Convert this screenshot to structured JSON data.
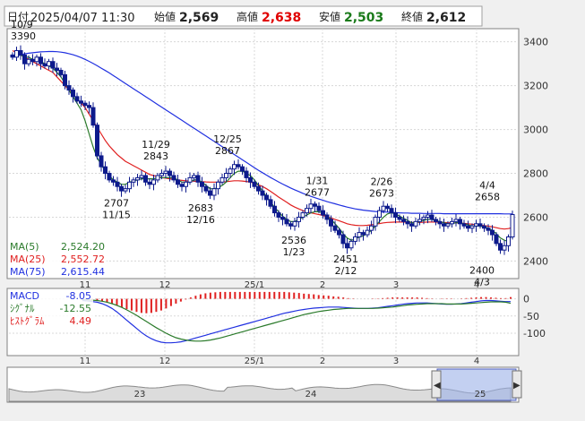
{
  "header": {
    "date_label": "日付",
    "datetime": "2025/04/07 11:30",
    "open_label": "始値",
    "open": "2,569",
    "high_label": "高値",
    "high": "2,638",
    "low_label": "安値",
    "low": "2,503",
    "close_label": "終値",
    "close": "2,612"
  },
  "colors": {
    "up": "#0d1a8c",
    "down": "#0d1a8c",
    "ma5": "#2a7a2a",
    "ma25": "#e02020",
    "ma75": "#2030e0",
    "high_value": "#e00000",
    "low_value": "#1a7a1a",
    "macd": "#2030e0",
    "signal": "#2a7a2a",
    "histogram": "#e02020"
  },
  "legend": {
    "ma5_label": "MA(5)",
    "ma5_value": "2,524.20",
    "ma25_label": "MA(25)",
    "ma25_value": "2,552.72",
    "ma75_label": "MA(75)",
    "ma75_value": "2,615.44"
  },
  "macd_legend": {
    "macd_label": "MACD",
    "macd_value": "-8.05",
    "signal_label": "ｼｸﾞﾅﾙ",
    "signal_value": "-12.55",
    "hist_label": "ﾋｽﾄｸﾞﾗﾑ",
    "hist_value": "4.49"
  },
  "chart_data": {
    "type": "candlestick",
    "y_ticks": [
      "3400",
      "3200",
      "3000",
      "2800",
      "2600",
      "2400"
    ],
    "ylim": [
      2320,
      3460
    ],
    "x_ticks": [
      "11",
      "12",
      "25/1",
      "2",
      "3",
      "4"
    ],
    "macd_ticks": [
      "0",
      "-50",
      "-100"
    ],
    "macd_ylim": [
      -160,
      25
    ],
    "navigator_labels": [
      "23",
      "24",
      "25"
    ],
    "annotations": [
      {
        "date": "10/9",
        "value": "3390",
        "pos": "above"
      },
      {
        "date": "11/29",
        "value": "2843",
        "pos": "above"
      },
      {
        "date": "12/25",
        "value": "2867",
        "pos": "above"
      },
      {
        "date": "1/31",
        "value": "2677",
        "pos": "above"
      },
      {
        "date": "2/26",
        "value": "2673",
        "pos": "above"
      },
      {
        "date": "4/4",
        "value": "2658",
        "pos": "above"
      },
      {
        "date": "11/15",
        "value": "2707",
        "pos": "below"
      },
      {
        "date": "12/16",
        "value": "2683",
        "pos": "below"
      },
      {
        "date": "1/23",
        "value": "2536",
        "pos": "below"
      },
      {
        "date": "2/12",
        "value": "2451",
        "pos": "below"
      },
      {
        "date": "4/3",
        "value": "2400",
        "pos": "below"
      }
    ],
    "closes": [
      3330,
      3360,
      3340,
      3300,
      3320,
      3310,
      3330,
      3300,
      3290,
      3310,
      3280,
      3270,
      3250,
      3200,
      3180,
      3150,
      3130,
      3120,
      3110,
      3100,
      3020,
      2880,
      2830,
      2800,
      2770,
      2760,
      2740,
      2720,
      2730,
      2760,
      2770,
      2780,
      2790,
      2760,
      2750,
      2770,
      2790,
      2800,
      2810,
      2790,
      2770,
      2750,
      2740,
      2760,
      2780,
      2790,
      2760,
      2740,
      2720,
      2700,
      2730,
      2760,
      2780,
      2800,
      2820,
      2840,
      2830,
      2810,
      2780,
      2760,
      2740,
      2720,
      2700,
      2680,
      2650,
      2620,
      2600,
      2590,
      2570,
      2560,
      2580,
      2600,
      2620,
      2640,
      2660,
      2650,
      2630,
      2610,
      2590,
      2560,
      2540,
      2520,
      2480,
      2460,
      2490,
      2510,
      2530,
      2520,
      2540,
      2560,
      2600,
      2630,
      2650,
      2640,
      2620,
      2600,
      2590,
      2580,
      2570,
      2560,
      2580,
      2590,
      2600,
      2610,
      2590,
      2580,
      2570,
      2560,
      2570,
      2580,
      2590,
      2570,
      2560,
      2550,
      2560,
      2570,
      2560,
      2550,
      2540,
      2520,
      2480,
      2450,
      2470,
      2510,
      2612
    ],
    "ma5": [
      3330,
      3340,
      3340,
      3330,
      3330,
      3320,
      3315,
      3310,
      3300,
      3290,
      3280,
      3260,
      3240,
      3210,
      3180,
      3150,
      3120,
      3090,
      3040,
      2980,
      2920,
      2870,
      2840,
      2810,
      2790,
      2770,
      2760,
      2750,
      2750,
      2760,
      2765,
      2770,
      2775,
      2775,
      2775,
      2775,
      2780,
      2780,
      2780,
      2780,
      2780,
      2770,
      2760,
      2760,
      2760,
      2770,
      2770,
      2760,
      2745,
      2730,
      2730,
      2735,
      2745,
      2760,
      2780,
      2800,
      2810,
      2810,
      2800,
      2790,
      2770,
      2745,
      2720,
      2695,
      2670,
      2645,
      2625,
      2605,
      2590,
      2580,
      2580,
      2590,
      2600,
      2610,
      2620,
      2625,
      2625,
      2620,
      2605,
      2590,
      2570,
      2550,
      2525,
      2505,
      2495,
      2500,
      2510,
      2515,
      2525,
      2540,
      2560,
      2580,
      2600,
      2615,
      2620,
      2615,
      2605,
      2595,
      2585,
      2575,
      2575,
      2580,
      2585,
      2590,
      2590,
      2585,
      2580,
      2575,
      2570,
      2570,
      2575,
      2575,
      2570,
      2565,
      2560,
      2560,
      2560,
      2555,
      2550,
      2540,
      2525,
      2505,
      2495,
      2490,
      2524
    ],
    "ma25": [
      3360,
      3350,
      3340,
      3330,
      3320,
      3310,
      3300,
      3290,
      3280,
      3270,
      3260,
      3240,
      3220,
      3200,
      3180,
      3160,
      3140,
      3120,
      3100,
      3070,
      3040,
      3010,
      2980,
      2950,
      2925,
      2905,
      2885,
      2870,
      2855,
      2845,
      2835,
      2825,
      2815,
      2805,
      2795,
      2790,
      2785,
      2780,
      2778,
      2775,
      2772,
      2770,
      2768,
      2766,
      2765,
      2764,
      2763,
      2762,
      2761,
      2760,
      2760,
      2760,
      2761,
      2762,
      2764,
      2766,
      2766,
      2765,
      2763,
      2760,
      2755,
      2748,
      2740,
      2730,
      2718,
      2705,
      2692,
      2680,
      2668,
      2656,
      2646,
      2638,
      2630,
      2624,
      2620,
      2616,
      2612,
      2608,
      2602,
      2596,
      2590,
      2584,
      2577,
      2570,
      2566,
      2563,
      2562,
      2562,
      2563,
      2565,
      2568,
      2571,
      2574,
      2576,
      2577,
      2578,
      2578,
      2578,
      2577,
      2576,
      2576,
      2576,
      2577,
      2578,
      2578,
      2578,
      2577,
      2576,
      2575,
      2574,
      2574,
      2573,
      2572,
      2570,
      2568,
      2566,
      2564,
      2562,
      2559,
      2556,
      2552,
      2548,
      2546,
      2548,
      2553
    ],
    "ma75": [
      3330,
      3335,
      3340,
      3345,
      3348,
      3350,
      3352,
      3354,
      3355,
      3356,
      3356,
      3355,
      3353,
      3350,
      3346,
      3341,
      3335,
      3328,
      3320,
      3311,
      3301,
      3291,
      3280,
      3269,
      3258,
      3246,
      3234,
      3222,
      3210,
      3198,
      3186,
      3174,
      3162,
      3150,
      3138,
      3126,
      3114,
      3102,
      3090,
      3078,
      3066,
      3054,
      3042,
      3030,
      3018,
      3006,
      2994,
      2982,
      2970,
      2958,
      2946,
      2934,
      2922,
      2910,
      2898,
      2886,
      2874,
      2862,
      2850,
      2838,
      2826,
      2814,
      2803,
      2792,
      2781,
      2771,
      2761,
      2751,
      2742,
      2733,
      2725,
      2717,
      2709,
      2702,
      2695,
      2689,
      2683,
      2677,
      2671,
      2666,
      2661,
      2656,
      2651,
      2646,
      2642,
      2638,
      2635,
      2632,
      2630,
      2628,
      2626,
      2625,
      2624,
      2623,
      2622,
      2621,
      2620,
      2619,
      2619,
      2618,
      2618,
      2618,
      2617,
      2617,
      2617,
      2617,
      2617,
      2616,
      2616,
      2616,
      2616,
      2616,
      2616,
      2616,
      2616,
      2616,
      2616,
      2616,
      2616,
      2616,
      2616,
      2616,
      2615,
      2615,
      2615
    ],
    "macd": [
      -5,
      -6,
      -8,
      -10,
      -14,
      -20,
      -28,
      -38,
      -50,
      -62,
      -74,
      -86,
      -98,
      -108,
      -116,
      -122,
      -126,
      -128,
      -128,
      -127,
      -125,
      -122,
      -118,
      -114,
      -110,
      -106,
      -102,
      -98,
      -94,
      -90,
      -86,
      -82,
      -78,
      -74,
      -70,
      -66,
      -62,
      -58,
      -54,
      -50,
      -46,
      -42,
      -39,
      -36,
      -33,
      -31,
      -29,
      -27,
      -26,
      -25,
      -24,
      -24,
      -24,
      -25,
      -26,
      -27,
      -28,
      -28,
      -28,
      -27,
      -26,
      -24,
      -22,
      -20,
      -18,
      -16,
      -14,
      -13,
      -12,
      -12,
      -12,
      -13,
      -14,
      -15,
      -16,
      -16,
      -15,
      -14,
      -12,
      -10,
      -8,
      -6,
      -5,
      -5,
      -6,
      -7,
      -8,
      -8
    ],
    "signal": [
      -2,
      -3,
      -4,
      -5,
      -7,
      -10,
      -14,
      -19,
      -25,
      -32,
      -40,
      -48,
      -57,
      -66,
      -75,
      -84,
      -92,
      -100,
      -107,
      -113,
      -117,
      -120,
      -122,
      -123,
      -123,
      -122,
      -120,
      -117,
      -114,
      -110,
      -106,
      -102,
      -98,
      -94,
      -90,
      -86,
      -82,
      -78,
      -74,
      -70,
      -66,
      -62,
      -58,
      -54,
      -50,
      -46,
      -43,
      -40,
      -37,
      -35,
      -33,
      -31,
      -30,
      -29,
      -28,
      -28,
      -28,
      -28,
      -28,
      -28,
      -27,
      -26,
      -25,
      -24,
      -22,
      -20,
      -18,
      -17,
      -16,
      -15,
      -14,
      -14,
      -14,
      -14,
      -15,
      -15,
      -15,
      -15,
      -14,
      -13,
      -12,
      -11,
      -10,
      -9,
      -9,
      -9,
      -10,
      -13
    ],
    "hist": [
      -3,
      -3,
      -4,
      -5,
      -7,
      -10,
      -14,
      -19,
      -25,
      -30,
      -34,
      -38,
      -41,
      -42,
      -41,
      -38,
      -34,
      -28,
      -21,
      -14,
      -8,
      -2,
      4,
      9,
      13,
      16,
      18,
      19,
      20,
      20,
      20,
      20,
      20,
      20,
      20,
      20,
      20,
      20,
      20,
      20,
      20,
      20,
      19,
      18,
      17,
      15,
      14,
      13,
      11,
      10,
      9,
      7,
      6,
      4,
      2,
      1,
      0,
      0,
      0,
      1,
      1,
      2,
      3,
      4,
      4,
      4,
      4,
      4,
      4,
      3,
      2,
      1,
      0,
      -1,
      -1,
      -1,
      0,
      1,
      2,
      3,
      4,
      5,
      5,
      4,
      3,
      2,
      2,
      5
    ]
  }
}
